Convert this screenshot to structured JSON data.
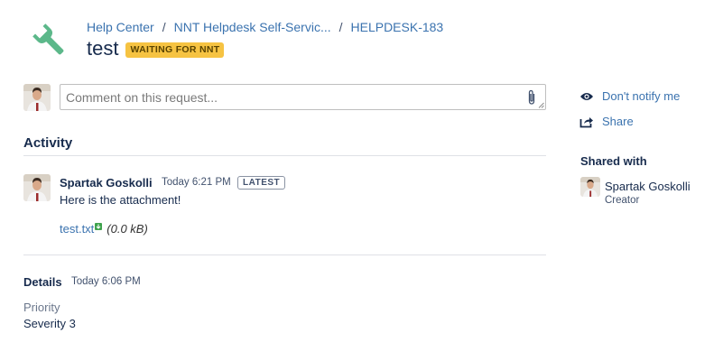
{
  "breadcrumb": {
    "items": [
      "Help Center",
      "NNT Helpdesk Self-Servic...",
      "HELPDESK-183"
    ],
    "separator": "/"
  },
  "request": {
    "title": "test",
    "status": "WAITING FOR NNT",
    "status_color": "#f6c342"
  },
  "comment": {
    "placeholder": "Comment on this request...",
    "attach_icon": "paperclip-icon"
  },
  "activity": {
    "heading": "Activity",
    "entry": {
      "author": "Spartak Goskolli",
      "time": "Today 6:21 PM",
      "badge": "LATEST",
      "body": "Here is the attachment!",
      "attachment": {
        "name": "test.txt",
        "size": "(0.0 kB)"
      }
    }
  },
  "details": {
    "heading": "Details",
    "time": "Today 6:06 PM",
    "field_label": "Priority",
    "field_value": "Severity 3"
  },
  "sidebar": {
    "notify_label": "Don't notify me",
    "share_label": "Share",
    "shared_with_heading": "Shared with",
    "shared_user": {
      "name": "Spartak Goskolli",
      "role": "Creator"
    }
  },
  "colors": {
    "link": "#3b73af",
    "logo": "#5cb88a",
    "text": "#172b4d"
  }
}
